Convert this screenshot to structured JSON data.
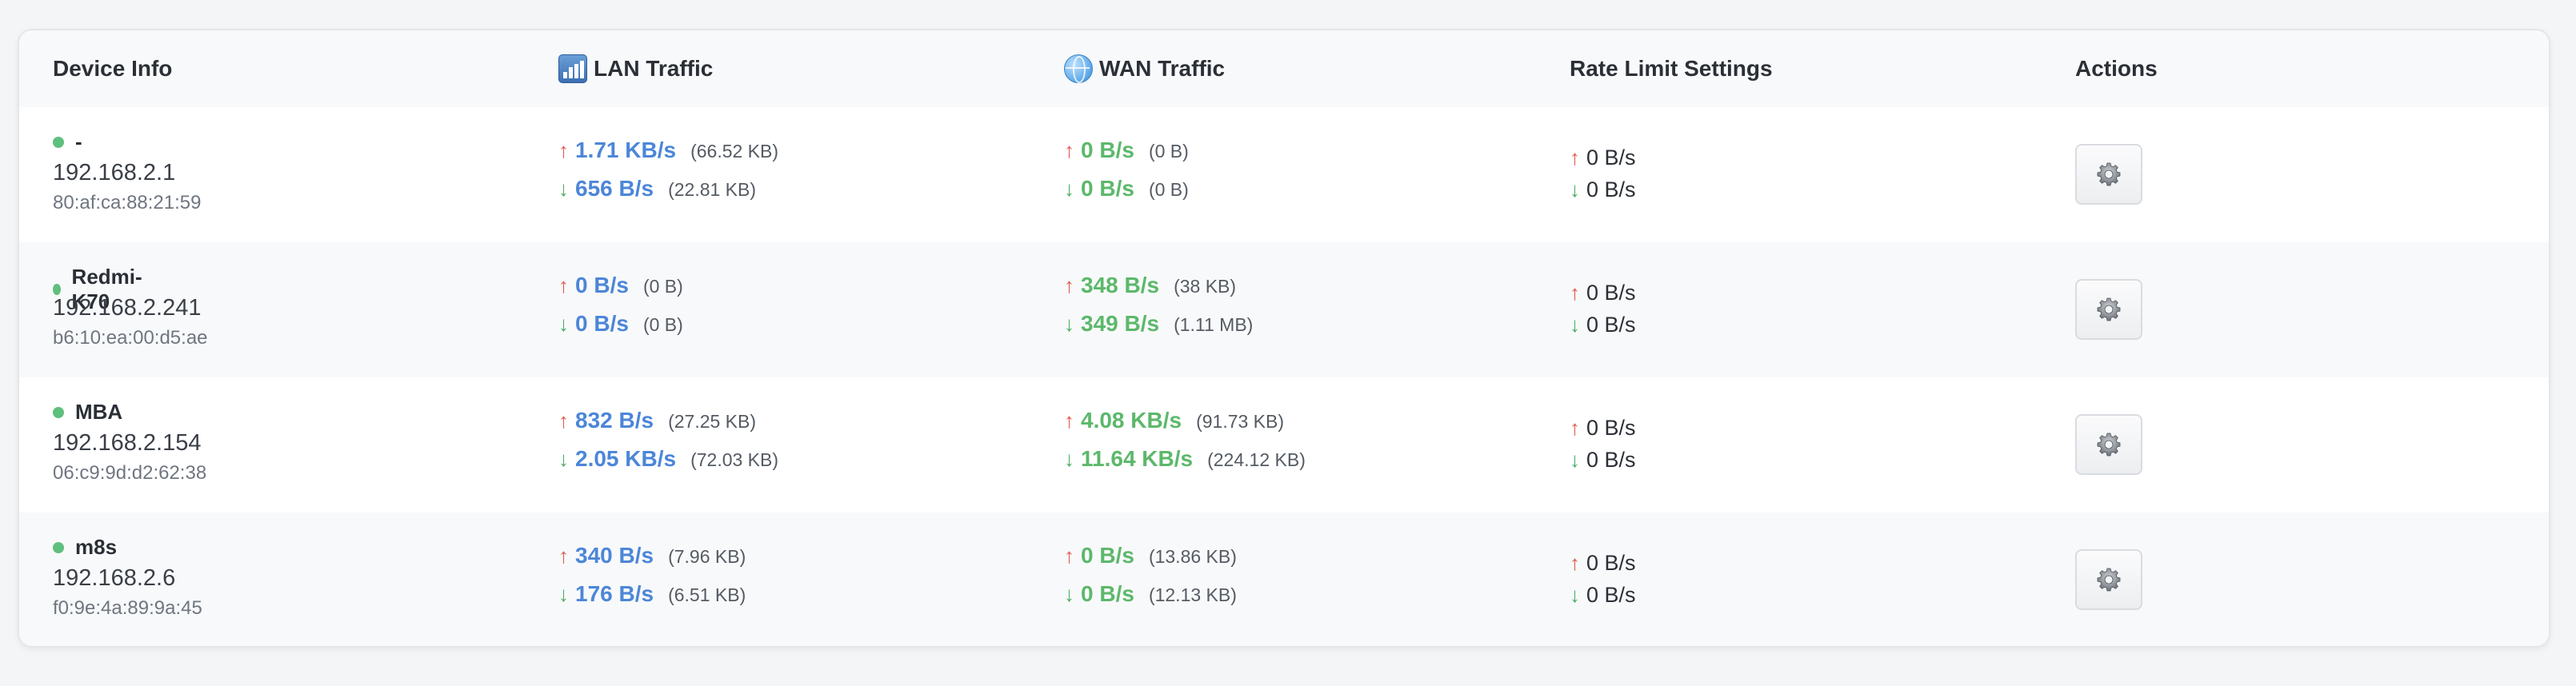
{
  "table": {
    "headers": {
      "device_info": "Device Info",
      "lan_traffic": "LAN Traffic",
      "wan_traffic": "WAN Traffic",
      "rate_limit": "Rate Limit Settings",
      "actions": "Actions"
    },
    "header_icons": {
      "lan": "bar-chart-icon",
      "wan": "globe-icon"
    },
    "rows": [
      {
        "name": "-",
        "status": "online",
        "ip": "192.168.2.1",
        "mac": "80:af:ca:88:21:59",
        "lan": {
          "up_rate": "1.71 KB/s",
          "up_total": "(66.52 KB)",
          "down_rate": "656 B/s",
          "down_total": "(22.81 KB)"
        },
        "wan": {
          "up_rate": "0 B/s",
          "up_total": "(0 B)",
          "down_rate": "0 B/s",
          "down_total": "(0 B)"
        },
        "limit": {
          "up": "0 B/s",
          "down": "0 B/s"
        }
      },
      {
        "name": "Redmi-K70",
        "status": "online",
        "ip": "192.168.2.241",
        "mac": "b6:10:ea:00:d5:ae",
        "lan": {
          "up_rate": "0 B/s",
          "up_total": "(0 B)",
          "down_rate": "0 B/s",
          "down_total": "(0 B)"
        },
        "wan": {
          "up_rate": "348 B/s",
          "up_total": "(38 KB)",
          "down_rate": "349 B/s",
          "down_total": "(1.11 MB)"
        },
        "limit": {
          "up": "0 B/s",
          "down": "0 B/s"
        }
      },
      {
        "name": "MBA",
        "status": "online",
        "ip": "192.168.2.154",
        "mac": "06:c9:9d:d2:62:38",
        "lan": {
          "up_rate": "832 B/s",
          "up_total": "(27.25 KB)",
          "down_rate": "2.05 KB/s",
          "down_total": "(72.03 KB)"
        },
        "wan": {
          "up_rate": "4.08 KB/s",
          "up_total": "(91.73 KB)",
          "down_rate": "11.64 KB/s",
          "down_total": "(224.12 KB)"
        },
        "limit": {
          "up": "0 B/s",
          "down": "0 B/s"
        }
      },
      {
        "name": "m8s",
        "status": "online",
        "ip": "192.168.2.6",
        "mac": "f0:9e:4a:89:9a:45",
        "lan": {
          "up_rate": "340 B/s",
          "up_total": "(7.96 KB)",
          "down_rate": "176 B/s",
          "down_total": "(6.51 KB)"
        },
        "wan": {
          "up_rate": "0 B/s",
          "up_total": "(13.86 KB)",
          "down_rate": "0 B/s",
          "down_total": "(12.13 KB)"
        },
        "limit": {
          "up": "0 B/s",
          "down": "0 B/s"
        }
      }
    ]
  },
  "icons": {
    "up_arrow": "↑",
    "down_arrow": "↓",
    "status": "status-dot-icon",
    "settings": "gear-icon"
  },
  "colors": {
    "online": "#5fbf7d",
    "upload_arrow": "#e05a4f",
    "download_arrow": "#4caf63",
    "lan_rate": "#4c86d8",
    "wan_rate": "#5cb86b"
  }
}
